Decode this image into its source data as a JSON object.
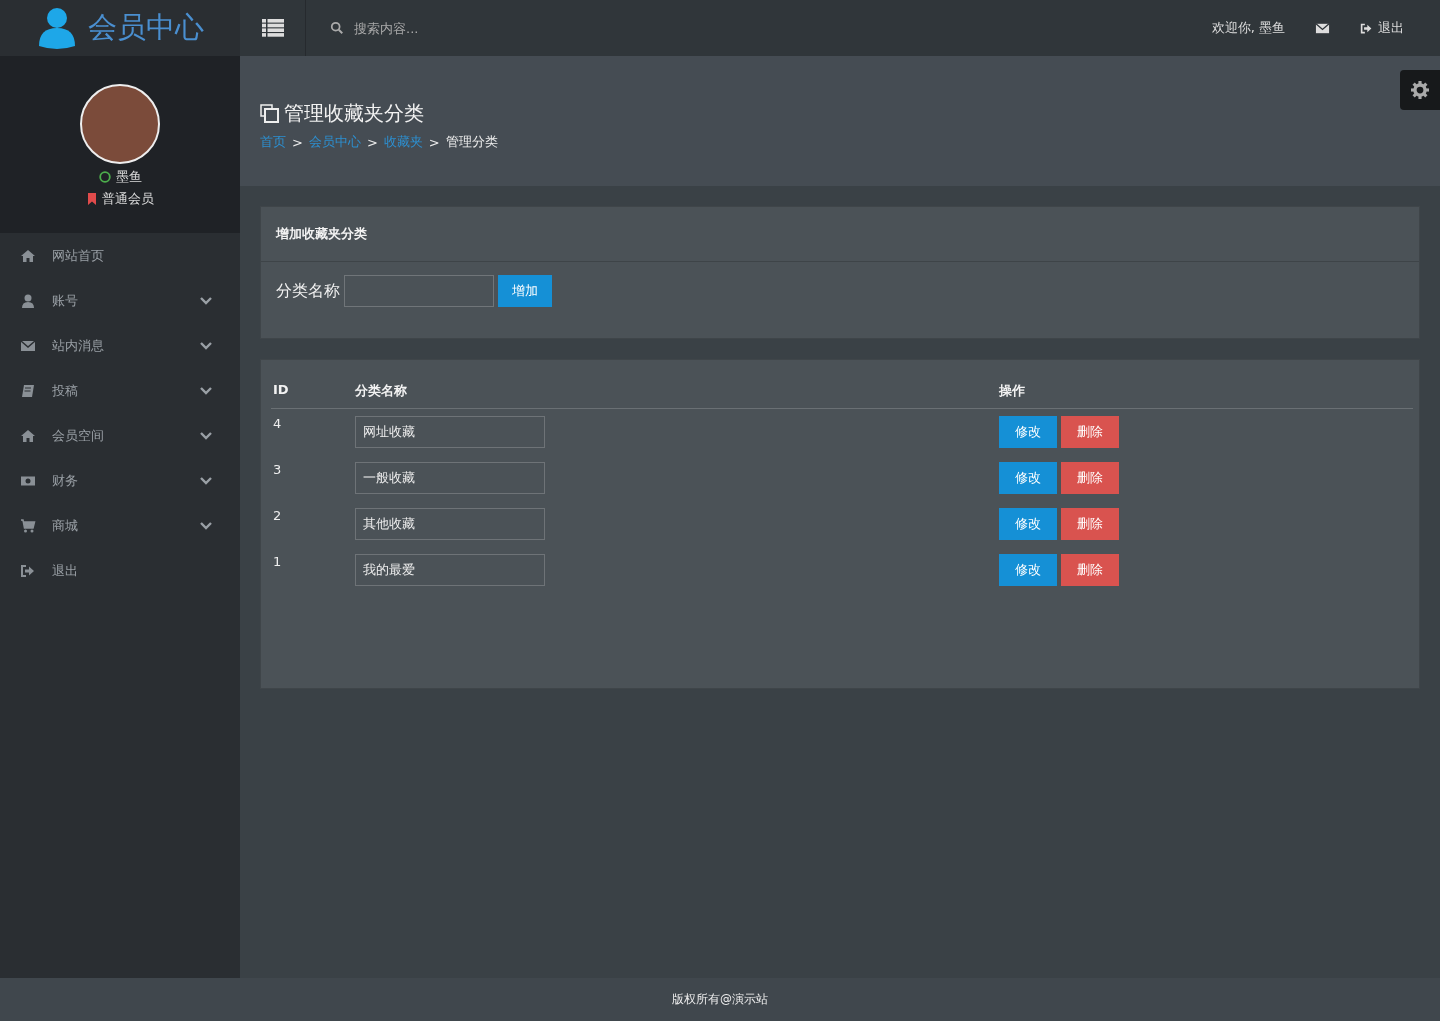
{
  "brand": {
    "title": "会员中心"
  },
  "topbar": {
    "search": {
      "placeholder": "搜索内容..."
    },
    "welcome": "欢迎你, 墨鱼",
    "logout": "退出"
  },
  "profile": {
    "name": "墨鱼",
    "online": true,
    "level": "普通会员"
  },
  "sidebar": {
    "items": [
      {
        "label": "网站首页",
        "kind": "link"
      },
      {
        "label": "账号",
        "kind": "menu"
      },
      {
        "label": "站内消息",
        "kind": "menu"
      },
      {
        "label": "投稿",
        "kind": "menu"
      },
      {
        "label": "会员空间",
        "kind": "menu"
      },
      {
        "label": "财务",
        "kind": "menu"
      },
      {
        "label": "商城",
        "kind": "menu"
      },
      {
        "label": "退出",
        "kind": "link"
      }
    ]
  },
  "page": {
    "title": "管理收藏夹分类",
    "breadcrumb": [
      {
        "label": "首页",
        "kind": "link"
      },
      {
        "label": "会员中心",
        "kind": "link"
      },
      {
        "label": "收藏夹",
        "kind": "link"
      },
      {
        "label": "管理分类",
        "kind": "current"
      }
    ],
    "separator": ">"
  },
  "add_panel": {
    "title": "增加收藏夹分类",
    "label": "分类名称",
    "button": "增加"
  },
  "table": {
    "columns": [
      "ID",
      "分类名称",
      "操作"
    ],
    "rows": [
      {
        "id": "4",
        "name": "网址收藏",
        "edit": "修改",
        "delete": "删除"
      },
      {
        "id": "3",
        "name": "一般收藏",
        "edit": "修改",
        "delete": "删除"
      },
      {
        "id": "2",
        "name": "其他收藏",
        "edit": "修改",
        "delete": "删除"
      },
      {
        "id": "1",
        "name": "我的最爱",
        "edit": "修改",
        "delete": "删除"
      }
    ]
  },
  "footer": "版权所有@演示站"
}
